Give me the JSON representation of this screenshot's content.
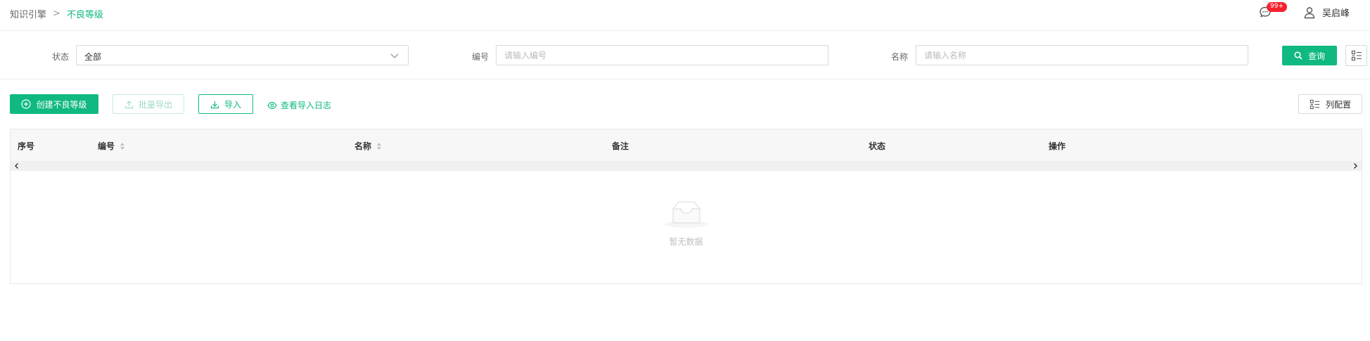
{
  "breadcrumb": {
    "root": "知识引擎",
    "separator": ">",
    "current": "不良等级"
  },
  "header": {
    "notification_icon": "message-icon",
    "notification_badge": "99+",
    "user_icon": "user-icon",
    "user_name": "吴启峰"
  },
  "filters": {
    "status_label": "状态",
    "status_value": "全部",
    "code_label": "编号",
    "code_placeholder": "请输入编号",
    "name_label": "名称",
    "name_placeholder": "请输入名称",
    "query_label": "查询"
  },
  "toolbar": {
    "create_label": "创建不良等级",
    "export_label": "批量导出",
    "import_label": "导入",
    "log_label": "查看导入日志",
    "column_config_label": "列配置"
  },
  "table": {
    "columns": [
      "序号",
      "编号",
      "名称",
      "备注",
      "状态",
      "操作"
    ],
    "rows": [],
    "empty_text": "暂无数据"
  },
  "colors": {
    "primary": "#10b981",
    "badge": "#f5222d"
  }
}
